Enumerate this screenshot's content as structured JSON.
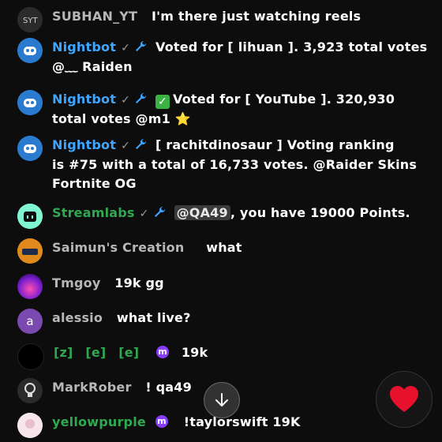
{
  "messages": [
    {
      "author": "SUBHAN_YT",
      "text": "I'm there just watching reels"
    },
    {
      "author": "Nightbot",
      "text": "Voted for [ lihuan ]. 3,923 total votes",
      "line2": "@﹏ Raiden"
    },
    {
      "author": "Nightbot",
      "text": "Voted for [ YouTube ]. 320,930",
      "line2": "total votes @m1",
      "line2_emoji": "⭐"
    },
    {
      "author": "Nightbot",
      "text": "[ rachitdinosaur ] Voting ranking",
      "line2": "is #75 with a total of 16,733 votes. @Raider Skins",
      "line3": "Fortnite OG"
    },
    {
      "author": "Streamlabs",
      "mention": "@QA49",
      "text": ", you have 19000 Points."
    },
    {
      "author": "Saimun's Creation",
      "text": "what"
    },
    {
      "author": "Tmgoy",
      "text": "19k gg"
    },
    {
      "author": "alessio",
      "text": "what live?",
      "avatar_letter": "a"
    },
    {
      "author": "",
      "parts": [
        "[z]",
        "[e]",
        "[e]"
      ],
      "text": "19k"
    },
    {
      "author": "MarkRober",
      "text": "! qa49"
    },
    {
      "author": "yellowpurple",
      "text": "!taylorswift 19K"
    }
  ],
  "colors": {
    "nightbot": "#3ea6ff",
    "streamlabs": "#2fa84f",
    "heart": "#e8112d"
  },
  "icons": {
    "check": "verified-check",
    "wrench": "moderator-wrench",
    "down": "arrow-down",
    "heart": "heart"
  }
}
